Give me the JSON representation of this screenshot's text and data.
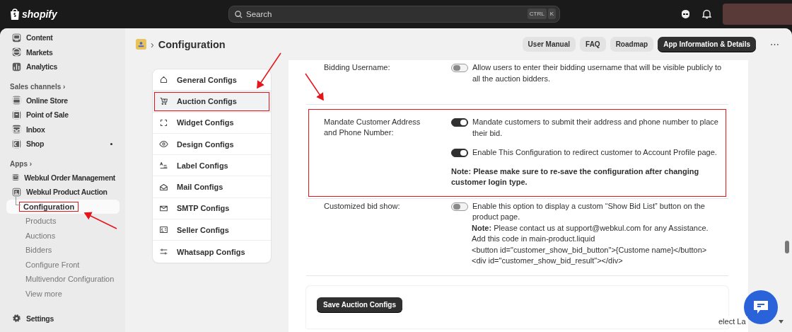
{
  "topbar": {
    "logo": "shopify",
    "search": {
      "placeholder": "Search",
      "shortcut": [
        "CTRL",
        "K"
      ]
    }
  },
  "sidebar": [
    {
      "kind": "item",
      "label": "Content",
      "selected": false,
      "dot": false,
      "highlighted": false
    },
    {
      "kind": "item",
      "label": "Markets",
      "selected": false,
      "dot": false,
      "highlighted": false
    },
    {
      "kind": "item",
      "label": "Analytics",
      "selected": false,
      "dot": false,
      "highlighted": false
    },
    {
      "kind": "heading",
      "label": "Sales channels",
      "chevron": "›"
    },
    {
      "kind": "item",
      "label": "Online Store",
      "selected": false,
      "dot": false,
      "highlighted": false
    },
    {
      "kind": "item",
      "label": "Point of Sale",
      "selected": false,
      "dot": false,
      "highlighted": false
    },
    {
      "kind": "item",
      "label": "Inbox",
      "selected": false,
      "dot": false,
      "highlighted": false
    },
    {
      "kind": "item",
      "label": "Shop",
      "selected": false,
      "dot": true,
      "highlighted": false
    },
    {
      "kind": "heading",
      "label": "Apps",
      "chevron": "›"
    },
    {
      "kind": "item",
      "label": "Webkul Order Management",
      "selected": false,
      "dot": false,
      "highlighted": false
    },
    {
      "kind": "item",
      "label": "Webkul Product Auction",
      "selected": false,
      "dot": false,
      "highlighted": false
    },
    {
      "kind": "subitem",
      "label": "Configuration",
      "selected": true,
      "dot": false,
      "highlighted": true
    },
    {
      "kind": "subitem",
      "label": "Products",
      "selected": false,
      "dot": false,
      "highlighted": false
    },
    {
      "kind": "subitem",
      "label": "Auctions",
      "selected": false,
      "dot": false,
      "highlighted": false
    },
    {
      "kind": "subitem",
      "label": "Bidders",
      "selected": false,
      "dot": false,
      "highlighted": false
    },
    {
      "kind": "subitem",
      "label": "Configure Front",
      "selected": false,
      "dot": false,
      "highlighted": false
    },
    {
      "kind": "subitem",
      "label": "Multivendor Configuration",
      "selected": false,
      "dot": false,
      "highlighted": false
    },
    {
      "kind": "subitem",
      "label": "View more",
      "selected": false,
      "dot": false,
      "highlighted": false
    },
    {
      "kind": "settings",
      "label": "Settings"
    }
  ],
  "header": {
    "separator": "›",
    "title": "Configuration",
    "buttons": [
      {
        "label": "User Manual",
        "primary": false
      },
      {
        "label": "FAQ",
        "primary": false
      },
      {
        "label": "Roadmap",
        "primary": false
      },
      {
        "label": "App Information & Details",
        "primary": true
      }
    ],
    "more": "⋯"
  },
  "config_nav": [
    {
      "label": "General Configs",
      "selected": false,
      "highlighted": false
    },
    {
      "label": "Auction Configs",
      "selected": true,
      "highlighted": true
    },
    {
      "label": "Widget Configs",
      "selected": false,
      "highlighted": false
    },
    {
      "label": "Design Configs",
      "selected": false,
      "highlighted": false
    },
    {
      "label": "Label Configs",
      "selected": false,
      "highlighted": false
    },
    {
      "label": "Mail Configs",
      "selected": false,
      "highlighted": false
    },
    {
      "label": "SMTP Configs",
      "selected": false,
      "highlighted": false
    },
    {
      "label": "Seller Configs",
      "selected": false,
      "highlighted": false
    },
    {
      "label": "Whatsapp Configs",
      "selected": false,
      "highlighted": false
    }
  ],
  "settings": [
    {
      "label": "Bidding Username:",
      "highlighted": false,
      "options": [
        {
          "on": false,
          "text": "Allow users to enter their bidding username that will be visible publicly to all the auction bidders."
        }
      ]
    },
    {
      "label": "Mandate Customer Address and Phone Number:",
      "highlighted": true,
      "options": [
        {
          "on": true,
          "text": "Mandate customers to submit their address and phone number to place their bid."
        },
        {
          "on": true,
          "text": "Enable This Configuration to redirect customer to Account Profile page."
        }
      ],
      "note": "Note:  Please make sure to re-save the configuration after changing customer login type."
    },
    {
      "label": "Customized bid show:",
      "highlighted": false,
      "options": [
        {
          "on": false,
          "text": "Enable this option to display a custom “Show Bid List” button on the product page."
        }
      ],
      "details": [
        "**Note:** Please contact us at support@webkul.com for any Assistance.",
        "Add this code in main-product.liquid",
        "<button id=\"customer_show_bid_button\">{Custome name}</button>",
        "<div id=\"customer_show_bid_result\"></div>"
      ]
    }
  ],
  "save_button": "Save Auction Configs",
  "language_select": "elect La"
}
